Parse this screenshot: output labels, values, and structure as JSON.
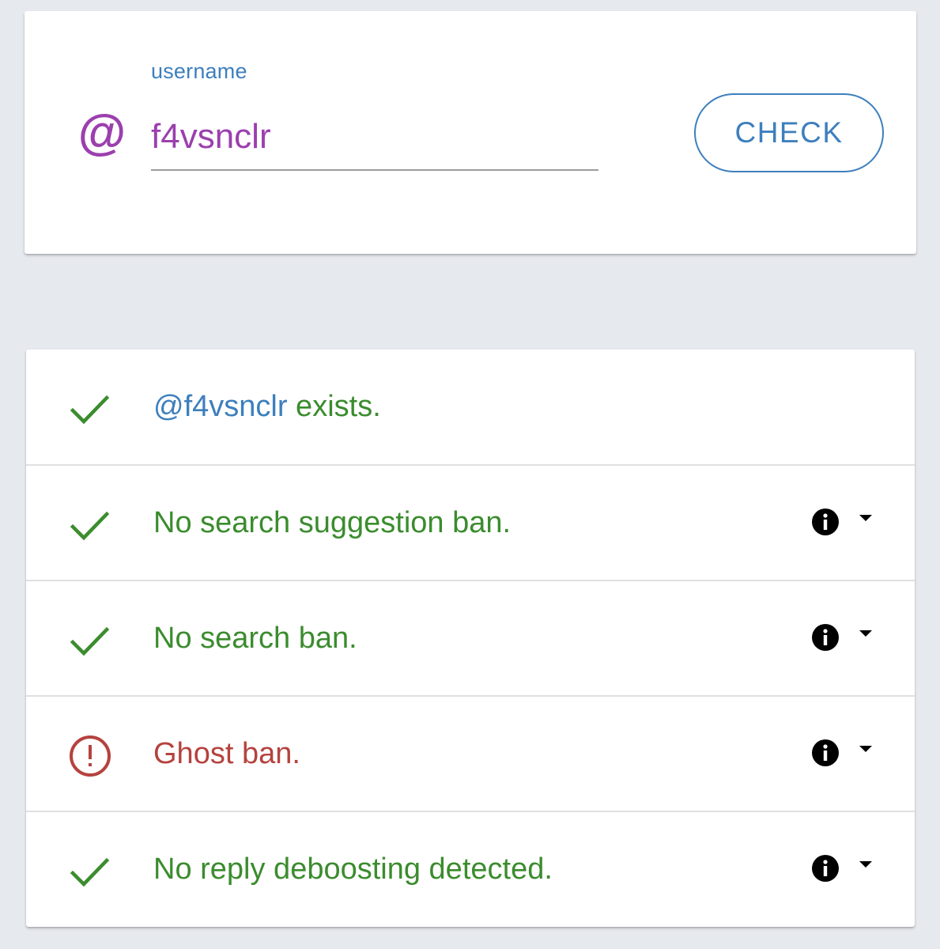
{
  "search": {
    "label": "username",
    "at_symbol": "@",
    "value": "f4vsnclr",
    "button_label": "CHECK"
  },
  "results": {
    "items": [
      {
        "status": "ok",
        "handle": "@f4vsnclr",
        "text": " exists.",
        "has_info": false
      },
      {
        "status": "ok",
        "text": "No search suggestion ban.",
        "has_info": true
      },
      {
        "status": "ok",
        "text": "No search ban.",
        "has_info": true
      },
      {
        "status": "alert",
        "text": "Ghost ban.",
        "has_info": true
      },
      {
        "status": "ok",
        "text": "No reply deboosting detected.",
        "has_info": true
      }
    ]
  },
  "colors": {
    "accent_blue": "#3d7fbd",
    "input_purple": "#9b3fae",
    "ok_green": "#3b8c2e",
    "alert_red": "#b5423e",
    "background": "#e6e9ee"
  },
  "icons": {
    "ok": "check-icon",
    "alert": "exclamation-circle-icon",
    "info": "info-icon",
    "expand": "caret-down-icon",
    "field": "at-sign-icon"
  }
}
